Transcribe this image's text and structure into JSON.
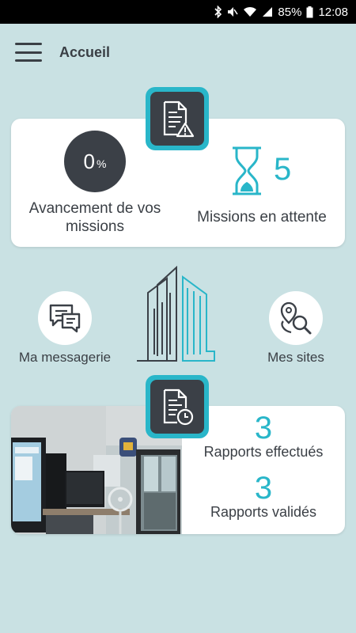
{
  "status_bar": {
    "battery": "85%",
    "time": "12:08",
    "icons": [
      "bluetooth-icon",
      "mute-icon",
      "wifi-icon",
      "signal-icon",
      "battery-icon"
    ]
  },
  "app_bar": {
    "title": "Accueil",
    "menu_icon": "hamburger-menu-icon"
  },
  "colors": {
    "background": "#c9e1e3",
    "accent": "#29b6c9",
    "dark": "#3b4047",
    "card": "#ffffff"
  },
  "missions": {
    "badge_icon": "document-warning-icon",
    "progress_value": "0",
    "progress_unit": "%",
    "progress_label": "Avancement de vos missions",
    "pending_icon": "hourglass-icon",
    "pending_count": "5",
    "pending_label": "Missions en attente"
  },
  "shortcuts": {
    "messaging": {
      "label": "Ma messagerie",
      "icon": "chat-bubbles-icon"
    },
    "sites": {
      "label": "Mes sites",
      "icon": "location-search-icon"
    },
    "center_icon": "building-icon"
  },
  "reports": {
    "badge_icon": "document-clock-icon",
    "image": "office-photo",
    "done_count": "3",
    "done_label": "Rapports effectués",
    "validated_count": "3",
    "validated_label": "Rapports validés"
  }
}
